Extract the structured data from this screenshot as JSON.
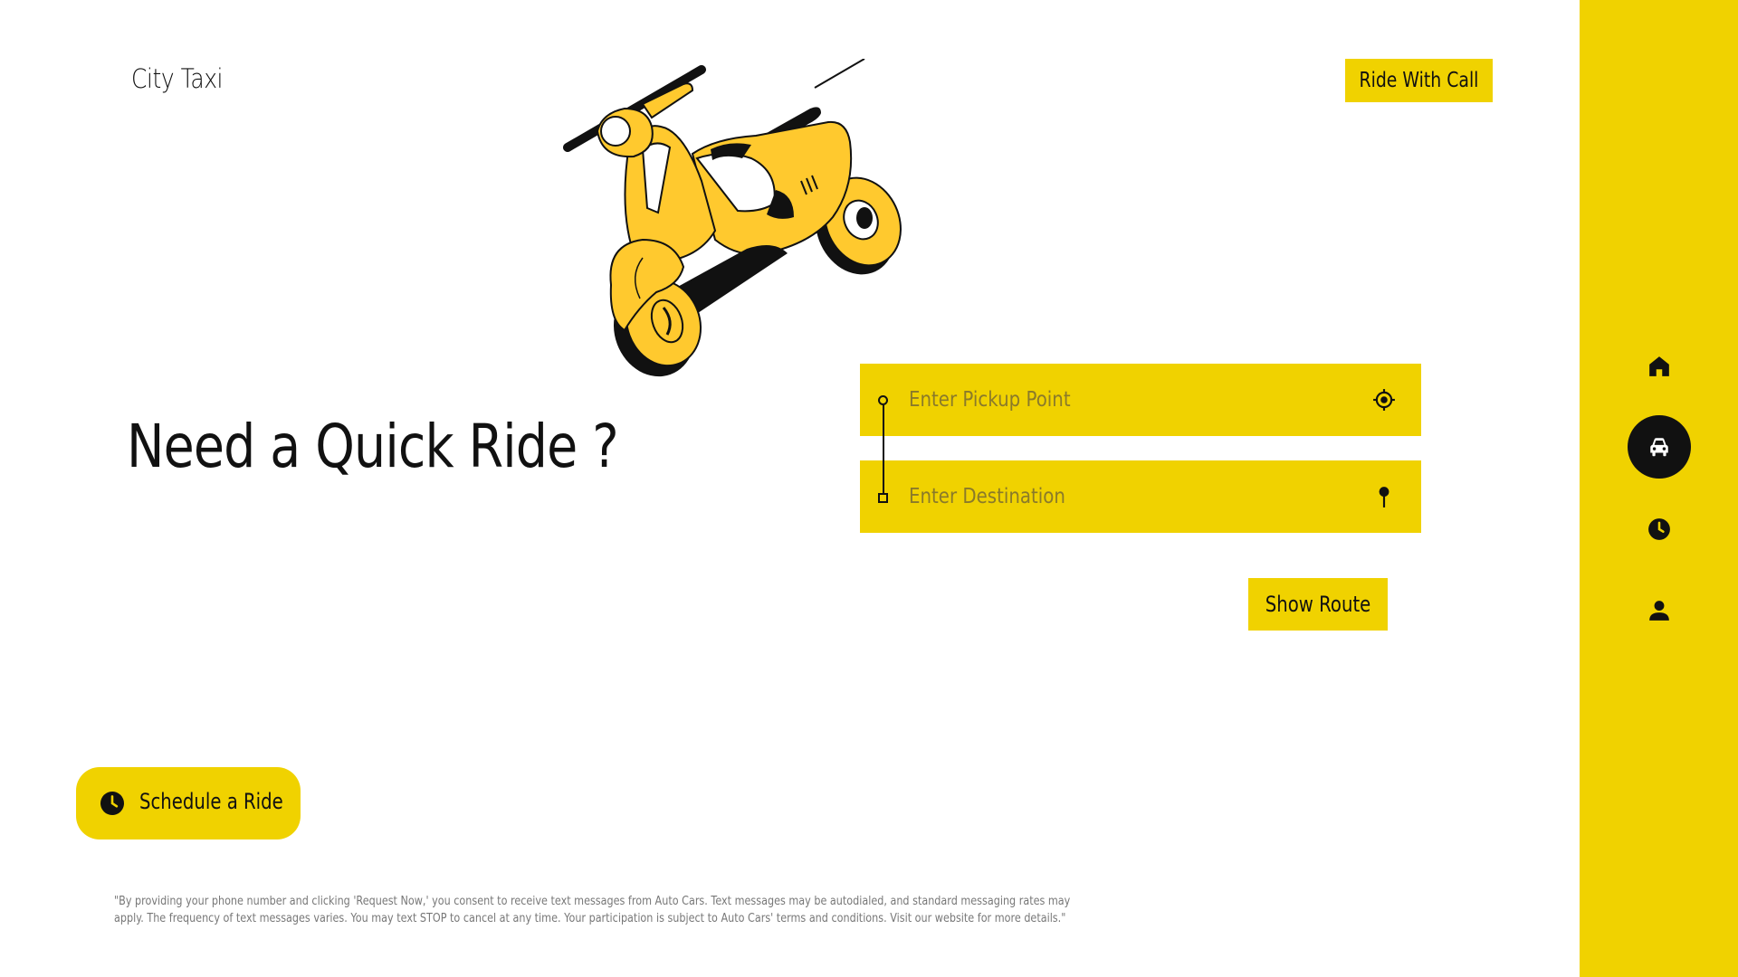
{
  "header": {
    "brand": "City Taxi",
    "ride_with_call_label": "Ride With Call"
  },
  "hero": {
    "headline": "Need a Quick Ride ?"
  },
  "route": {
    "pickup_placeholder": "Enter Pickup Point",
    "pickup_value": "",
    "destination_placeholder": "Enter Destination",
    "destination_value": "",
    "show_route_label": "Show Route"
  },
  "schedule": {
    "label": "Schedule a Ride"
  },
  "disclaimer": "\"By providing your phone number and clicking 'Request Now,' you consent to receive text messages from Auto Cars. Text messages may be autodialed, and standard messaging rates may apply. The frequency of text messages varies. You may text STOP to cancel at any time. Your participation is subject to Auto Cars' terms and conditions. Visit our website for more details.\"",
  "sidebar": {
    "items": [
      {
        "icon": "home-icon",
        "active": false
      },
      {
        "icon": "car-icon",
        "active": true
      },
      {
        "icon": "clock-icon",
        "active": false
      },
      {
        "icon": "user-icon",
        "active": false
      }
    ]
  },
  "colors": {
    "accent": "#F0D200",
    "text": "#111111",
    "muted": "#777777",
    "scooter_body": "#FFC92E"
  }
}
